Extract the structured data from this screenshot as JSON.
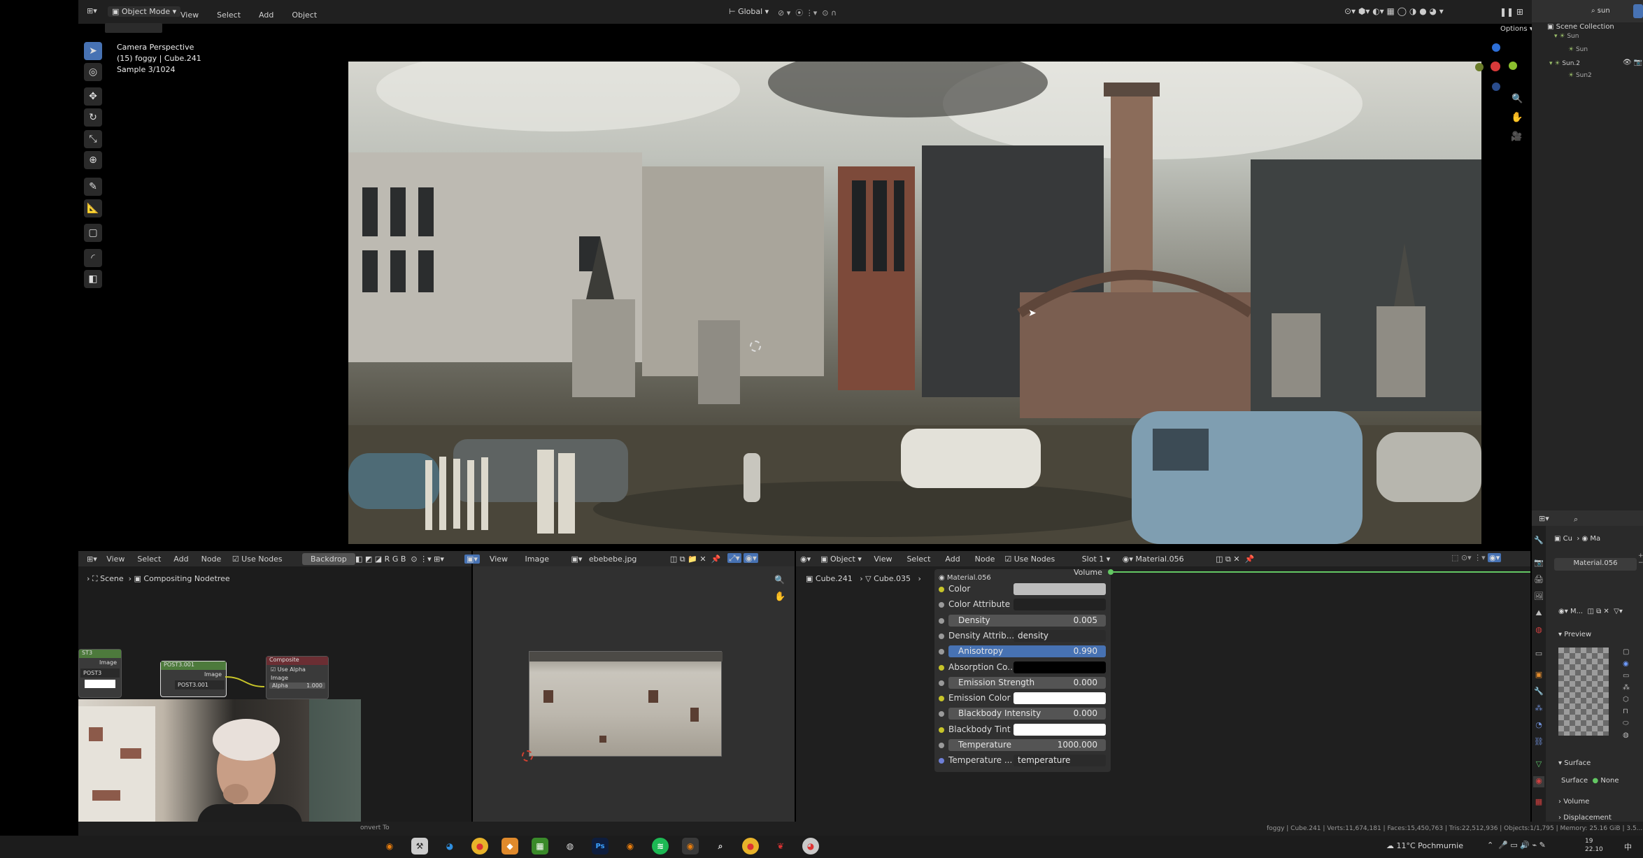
{
  "header": {
    "mode": "Object Mode",
    "menus": [
      "View",
      "Select",
      "Add",
      "Object"
    ],
    "transform_orientation": "Global",
    "options_label": "Options"
  },
  "viewport": {
    "overlay_line1": "Camera Perspective",
    "overlay_line2": "(15) foggy | Cube.241",
    "overlay_line3": "Sample 3/1024",
    "render_description": "foggy industrial render"
  },
  "outliner": {
    "title": "Scene Collection",
    "items": [
      "Sun",
      "Sun",
      "Sun.2",
      "Sun2"
    ],
    "search_placeholder": "sun"
  },
  "compositor": {
    "menus": [
      "View",
      "Select",
      "Add",
      "Node"
    ],
    "use_nodes": "Use Nodes",
    "backdrop": "Backdrop",
    "breadcrumb_scene": "Scene",
    "breadcrumb_tree": "Compositing Nodetree",
    "channels": [
      "R",
      "G",
      "B"
    ],
    "node1_title": "ST3",
    "node1_socket": "Image",
    "node1_name": "POST3",
    "node2_title": "POST3.001",
    "node2_socket": "Image",
    "node2_name": "POST3.001",
    "node3_title": "Composite",
    "node3_use_alpha": "Use Alpha",
    "node3_image": "Image",
    "node3_alpha": "Alpha",
    "node3_alpha_value": "1.000"
  },
  "image_editor": {
    "menus": [
      "View",
      "Image"
    ],
    "image_name": "ebebebe.jpg"
  },
  "shader_editor": {
    "object_label": "Object",
    "menus": [
      "View",
      "Select",
      "Add",
      "Node"
    ],
    "use_nodes": "Use Nodes",
    "slot": "Slot 1",
    "material": "Material.056",
    "breadcrumb_obj": "Cube.241",
    "breadcrumb_mesh": "Cube.035",
    "breadcrumb_mat": "Material.056",
    "volume_label": "Volume"
  },
  "volume_props": [
    {
      "label": "Color",
      "kind": "color",
      "value": "",
      "color": "#bdbdbd",
      "dot": "yellow"
    },
    {
      "label": "Color Attribute",
      "kind": "text",
      "value": "",
      "dot": "gray"
    },
    {
      "label": "Density",
      "kind": "number",
      "value": "0.005",
      "dot": "gray"
    },
    {
      "label": "Density Attrib...",
      "kind": "text",
      "value": "density",
      "dot": "gray"
    },
    {
      "label": "Anisotropy",
      "kind": "number",
      "value": "0.990",
      "dot": "gray",
      "active": true
    },
    {
      "label": "Absorption Co...",
      "kind": "color",
      "value": "",
      "color": "#000000",
      "dot": "yellow"
    },
    {
      "label": "Emission Strength",
      "kind": "number",
      "value": "0.000",
      "dot": "gray"
    },
    {
      "label": "Emission Color",
      "kind": "color",
      "value": "",
      "color": "#ffffff",
      "dot": "yellow"
    },
    {
      "label": "Blackbody Intensity",
      "kind": "number",
      "value": "0.000",
      "dot": "gray"
    },
    {
      "label": "Blackbody Tint",
      "kind": "color",
      "value": "",
      "color": "#ffffff",
      "dot": "yellow"
    },
    {
      "label": "Temperature",
      "kind": "number",
      "value": "1000.000",
      "dot": "gray"
    },
    {
      "label": "Temperature ...",
      "kind": "text",
      "value": "temperature",
      "dot": "blue"
    }
  ],
  "properties": {
    "tab_cu": "Cu",
    "tab_ma": "Ma",
    "material_name": "Material.056",
    "slot_label": "M...",
    "preview_label": "Preview",
    "surface_panel": "Surface",
    "surface_label": "Surface",
    "surface_value": "None",
    "volume_panel": "Volume",
    "displacement_panel": "Displacement"
  },
  "status": {
    "left_hint": "onvert To",
    "stats": "foggy | Cube.241 | Verts:11,674,181 | Faces:15,450,763 | Tris:22,512,936 | Objects:1/1,795 | Memory: 25.16 GiB | 3.5..."
  },
  "taskbar": {
    "weather": "11°C Pochmurnie",
    "clock_time": "19",
    "clock_date": "22.10",
    "lang": "中",
    "apps": [
      "blender",
      "folder",
      "chrome",
      "box",
      "nvidia",
      "obs",
      "ps",
      "blender",
      "spotify",
      "blender",
      "search",
      "chrome",
      "bird",
      "misc"
    ]
  }
}
